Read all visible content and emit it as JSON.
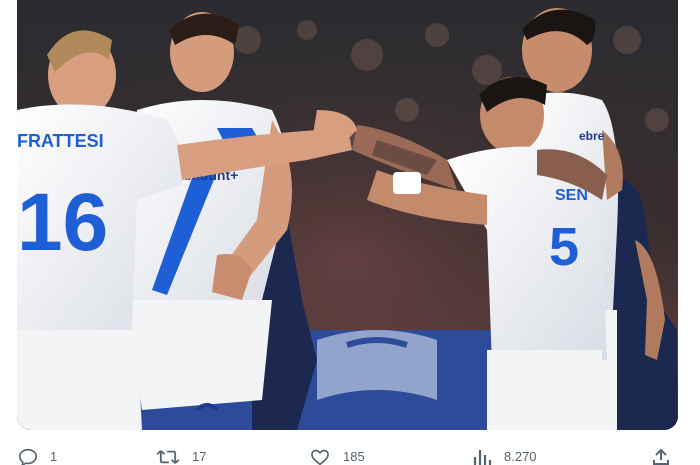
{
  "tweet": {
    "media": {
      "description_icon": "photo",
      "jersey_texts": {
        "left_player_name": "FRATTESI",
        "left_player_number": "16",
        "center_sponsor": "Paramount+",
        "right_player_number": "5",
        "right_player_name_fragment": "SEN",
        "back_player_sponsor": "ebre"
      }
    },
    "actions": {
      "reply_count": "1",
      "retweet_count": "17",
      "like_count": "185",
      "views_count": "8.270"
    }
  },
  "colors": {
    "icon_gray": "#536471",
    "jersey_white": "#f1f3f6",
    "inter_blue": "#1f5fd6"
  }
}
